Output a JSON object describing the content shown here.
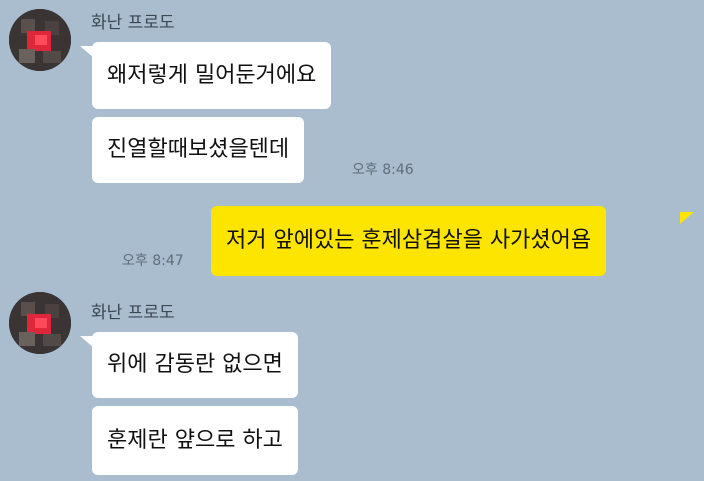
{
  "colors": {
    "background": "#a9bdce",
    "incoming_bubble": "#ffffff",
    "outgoing_bubble": "#fee500",
    "time_text": "#5f6e7a"
  },
  "groups": [
    {
      "sender": "화난 프로도",
      "messages": [
        {
          "text": "왜저렇게 밀어둔거에요"
        },
        {
          "text": "진열할때보셨을텐데",
          "time": "오후 8:46"
        }
      ]
    },
    {
      "sender": "me",
      "messages": [
        {
          "text": "저거 앞에있는 훈제삼겹살을 사가셨어욤",
          "time": "오후 8:47"
        }
      ]
    },
    {
      "sender": "화난 프로도",
      "messages": [
        {
          "text": "위에 감동란 없으면"
        },
        {
          "text": "훈제란 얖으로 하고"
        }
      ]
    }
  ]
}
